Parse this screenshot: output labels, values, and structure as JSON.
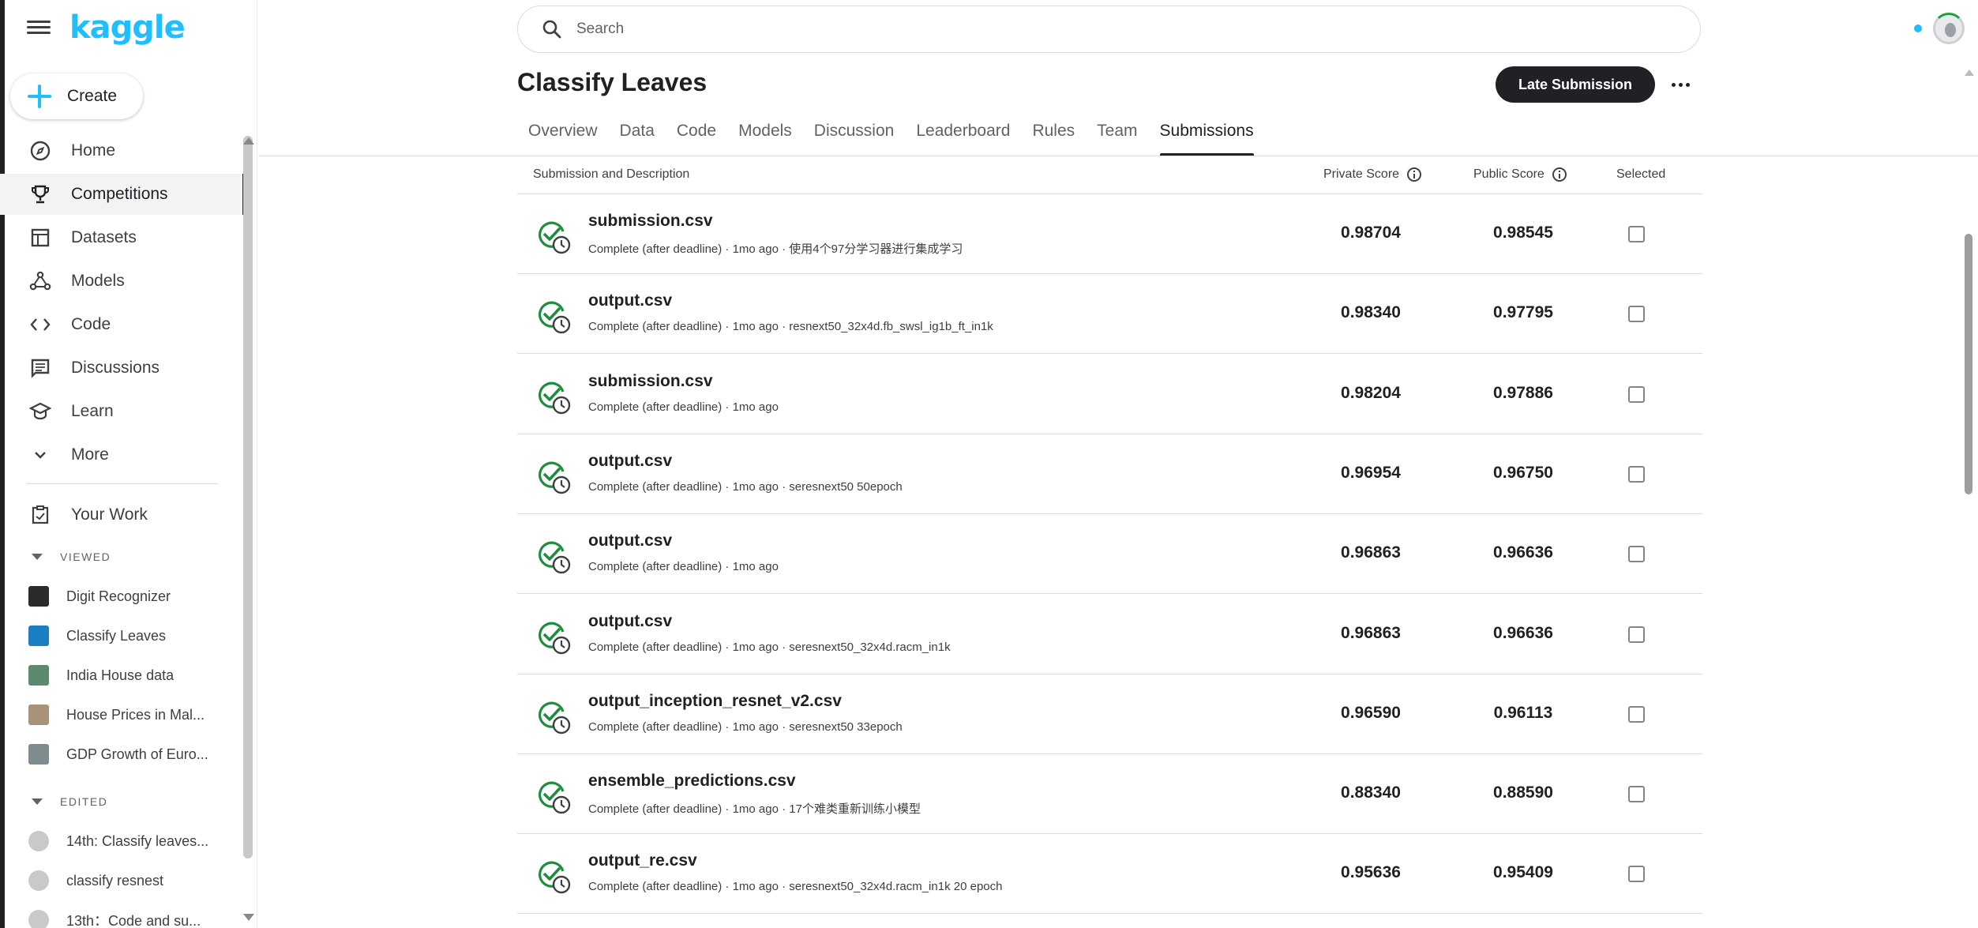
{
  "brand": {
    "logo_text": "kaggle"
  },
  "sidebar": {
    "create_label": "Create",
    "nav": [
      {
        "label": "Home",
        "icon": "compass-icon"
      },
      {
        "label": "Competitions",
        "icon": "trophy-icon",
        "active": true
      },
      {
        "label": "Datasets",
        "icon": "table-icon"
      },
      {
        "label": "Models",
        "icon": "models-icon"
      },
      {
        "label": "Code",
        "icon": "code-icon"
      },
      {
        "label": "Discussions",
        "icon": "discussion-icon"
      },
      {
        "label": "Learn",
        "icon": "graduation-cap-icon"
      },
      {
        "label": "More",
        "icon": "chevron-down-icon"
      }
    ],
    "your_work_label": "Your Work",
    "viewed_label": "VIEWED",
    "viewed": [
      {
        "label": "Digit Recognizer"
      },
      {
        "label": "Classify Leaves"
      },
      {
        "label": "India House data"
      },
      {
        "label": "House Prices in Mal..."
      },
      {
        "label": "GDP Growth of Euro..."
      }
    ],
    "edited_label": "EDITED",
    "edited": [
      {
        "label": "14th: Classify leaves..."
      },
      {
        "label": "classify resnest"
      },
      {
        "label": "13th：Code and su..."
      }
    ]
  },
  "search": {
    "placeholder": "Search"
  },
  "competition": {
    "title": "Classify Leaves",
    "late_submission_label": "Late Submission",
    "tabs": [
      "Overview",
      "Data",
      "Code",
      "Models",
      "Discussion",
      "Leaderboard",
      "Rules",
      "Team",
      "Submissions"
    ],
    "active_tab": "Submissions"
  },
  "table": {
    "headers": {
      "submission": "Submission and Description",
      "private": "Private Score",
      "public": "Public Score",
      "selected": "Selected"
    },
    "rows": [
      {
        "file": "submission.csv",
        "desc": "Complete (after deadline) · 1mo ago · 使用4个97分学习器进行集成学习",
        "private": "0.98704",
        "public": "0.98545"
      },
      {
        "file": "output.csv",
        "desc": "Complete (after deadline) · 1mo ago · resnext50_32x4d.fb_swsl_ig1b_ft_in1k",
        "private": "0.98340",
        "public": "0.97795"
      },
      {
        "file": "submission.csv",
        "desc": "Complete (after deadline) · 1mo ago",
        "private": "0.98204",
        "public": "0.97886"
      },
      {
        "file": "output.csv",
        "desc": "Complete (after deadline) · 1mo ago · seresnext50 50epoch",
        "private": "0.96954",
        "public": "0.96750"
      },
      {
        "file": "output.csv",
        "desc": "Complete (after deadline) · 1mo ago",
        "private": "0.96863",
        "public": "0.96636"
      },
      {
        "file": "output.csv",
        "desc": "Complete (after deadline) · 1mo ago · seresnext50_32x4d.racm_in1k",
        "private": "0.96863",
        "public": "0.96636"
      },
      {
        "file": "output_inception_resnet_v2.csv",
        "desc": "Complete (after deadline) · 1mo ago · seresnext50 33epoch",
        "private": "0.96590",
        "public": "0.96113"
      },
      {
        "file": "ensemble_predictions.csv",
        "desc": "Complete (after deadline) · 1mo ago · 17个难类重新训练小模型",
        "private": "0.88340",
        "public": "0.88590"
      },
      {
        "file": "output_re.csv",
        "desc": "Complete (after deadline) · 1mo ago · seresnext50_32x4d.racm_in1k 20 epoch",
        "private": "0.95636",
        "public": "0.95409"
      }
    ]
  },
  "colors": {
    "accent": "#20beff",
    "success": "#1e8e3e",
    "dark": "#202124"
  }
}
